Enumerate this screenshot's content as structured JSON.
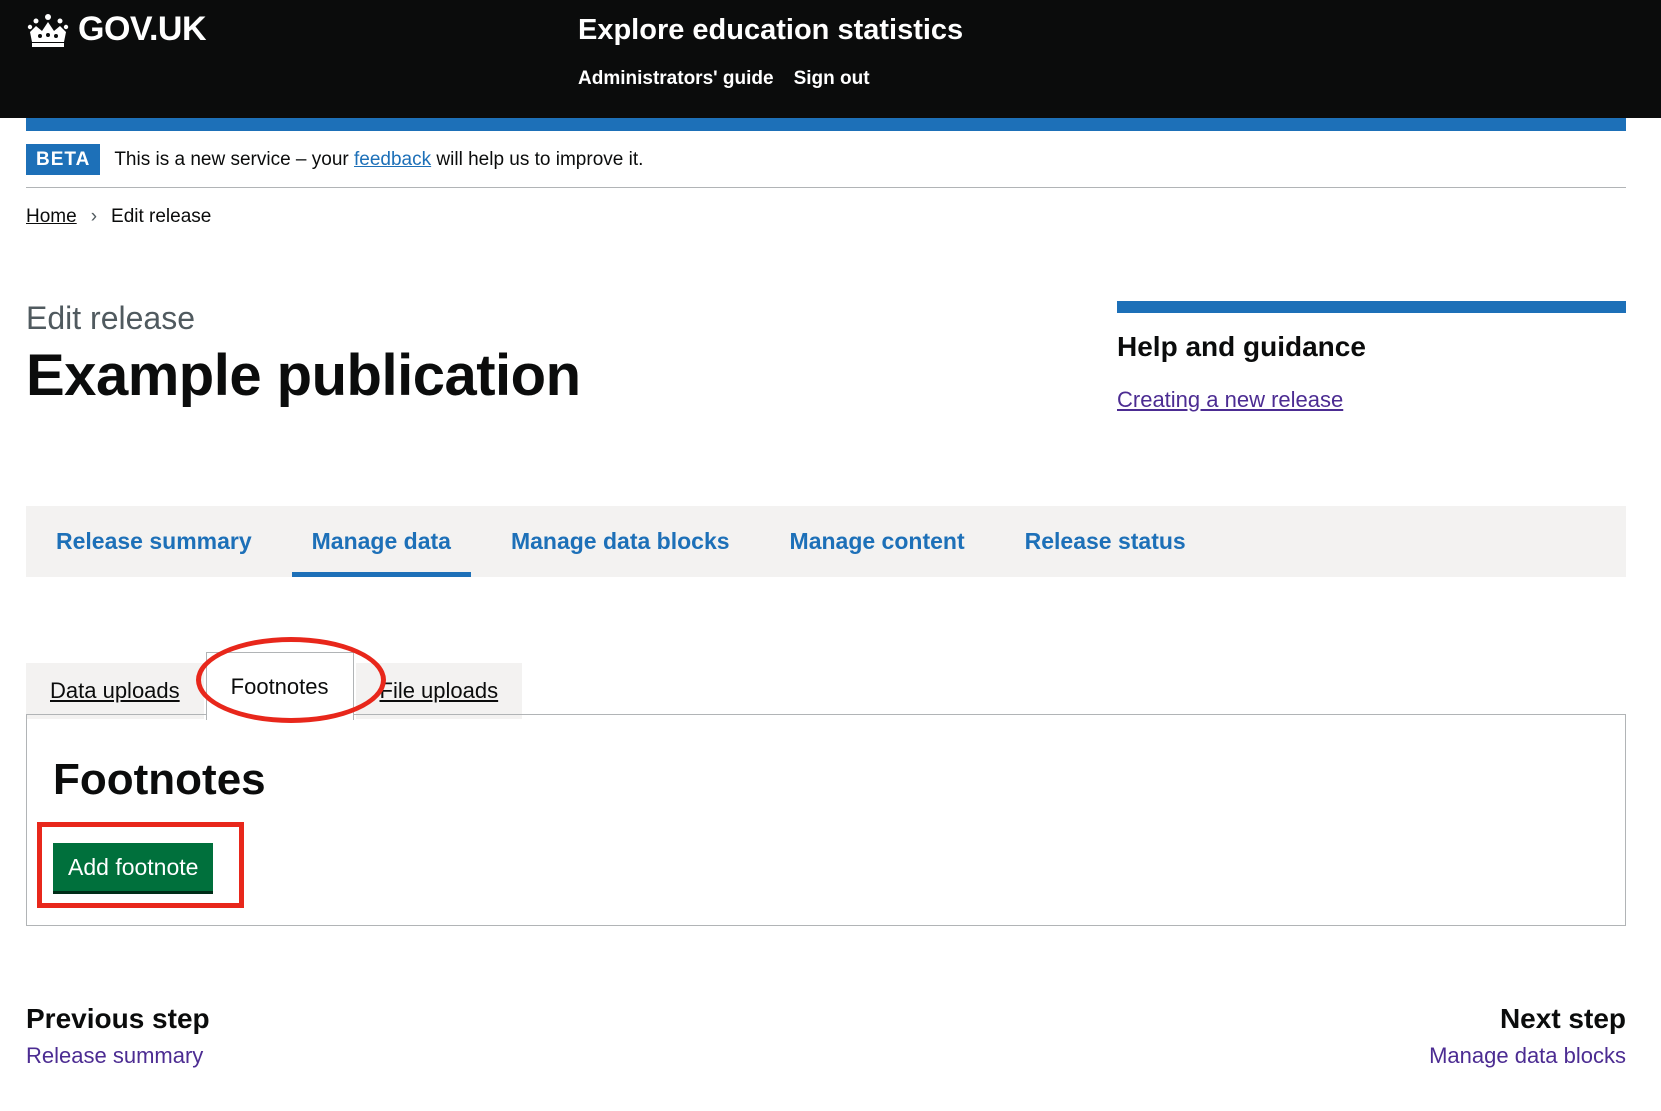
{
  "header": {
    "logo_text": "GOV.UK",
    "service_name": "Explore education statistics",
    "nav": [
      "Administrators' guide",
      "Sign out"
    ]
  },
  "phase_banner": {
    "tag": "BETA",
    "text_before": "This is a new service – your",
    "link": "feedback",
    "text_after": "will help us to improve it."
  },
  "breadcrumb": {
    "home": "Home",
    "current": "Edit release"
  },
  "page": {
    "caption": "Edit release",
    "title": "Example publication"
  },
  "help": {
    "heading": "Help and guidance",
    "link": "Creating a new release"
  },
  "nav": {
    "items": [
      "Release summary",
      "Manage data",
      "Manage data blocks",
      "Manage content",
      "Release status"
    ],
    "active": "Manage data"
  },
  "tabs": {
    "items": [
      "Data uploads",
      "Footnotes",
      "File uploads"
    ],
    "selected": "Footnotes"
  },
  "panel": {
    "title": "Footnotes",
    "button": "Add footnote"
  },
  "steps": {
    "previous_heading": "Previous step",
    "previous_link": "Release summary",
    "next_heading": "Next step",
    "next_link": "Manage data blocks"
  },
  "colors": {
    "header_bg": "#0b0c0c",
    "brand_blue": "#1d70b8",
    "button_green": "#00703c",
    "visited_link": "#4c2c92",
    "annotation_red": "#e8271b"
  }
}
